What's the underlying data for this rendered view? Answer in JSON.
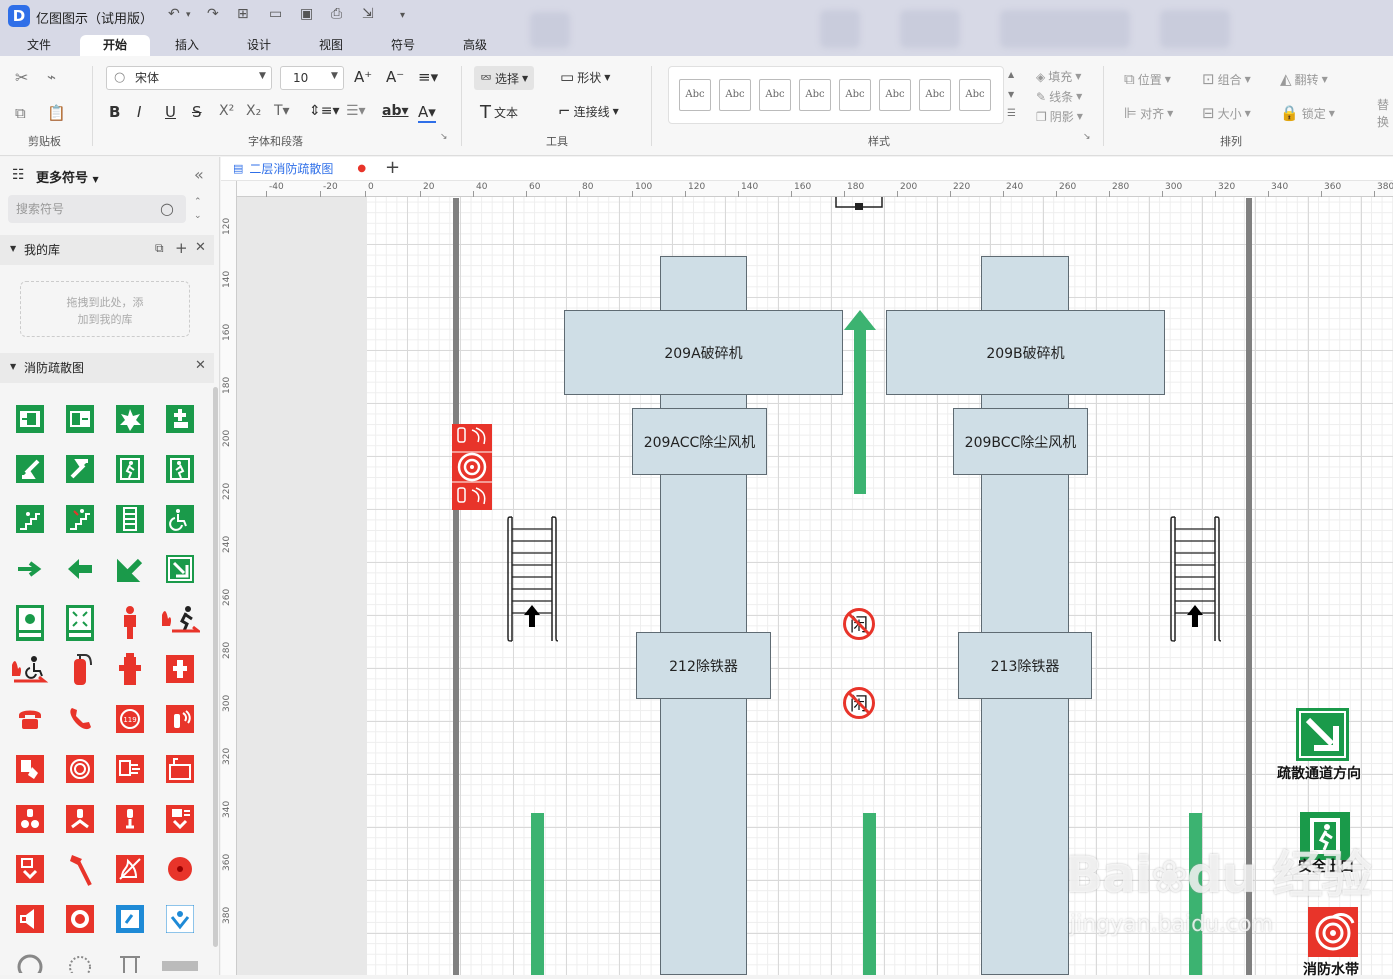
{
  "app": {
    "title": "亿图图示（试用版）"
  },
  "menu_tabs": [
    "文件",
    "开始",
    "插入",
    "设计",
    "视图",
    "符号",
    "高级"
  ],
  "ribbon": {
    "font_name": "宋体",
    "font_size": "10",
    "select_label": "选择",
    "shape_label": "形状",
    "text_label": "文本",
    "connector_label": "连接线",
    "fill_label": "填充",
    "line_label": "线条",
    "shadow_label": "阴影",
    "position_label": "位置",
    "group_label": "组合",
    "flip_label": "翻转",
    "align_label": "对齐",
    "size_label": "大小",
    "lock_label": "锁定",
    "replace_label": "替换",
    "style_sample": "Abc",
    "groups": {
      "clipboard": "剪贴板",
      "font": "字体和段落",
      "tools": "工具",
      "styles": "样式",
      "arrange": "排列"
    }
  },
  "sidebar": {
    "title": "更多符号",
    "search_placeholder": "搜索符号",
    "my_library": "我的库",
    "drop_hint_1": "拖拽到此处，添",
    "drop_hint_2": "加到我的库",
    "fire_library": "消防疏散图"
  },
  "document": {
    "tab_name": "二层消防疏散图"
  },
  "ruler": {
    "h_ticks": [
      "-40",
      "-20",
      "0",
      "20",
      "40",
      "60",
      "80",
      "100",
      "120",
      "140",
      "160",
      "180",
      "200",
      "220",
      "240",
      "260",
      "280",
      "300",
      "320",
      "340",
      "360",
      "380"
    ],
    "v_ticks": [
      "120",
      "140",
      "160",
      "180",
      "200",
      "220",
      "240",
      "260",
      "280",
      "300",
      "320",
      "340",
      "360",
      "380"
    ]
  },
  "diagram": {
    "crusher_a": "209A破碎机",
    "crusher_b": "209B破碎机",
    "fan_a": "209ACC除尘风机",
    "fan_b": "209BCC除尘风机",
    "iron_a": "212除铁器",
    "iron_b": "213除铁器",
    "evac_direction": "疏散通道方向",
    "safe_exit": "安全出口",
    "fire_hose": "消防水带",
    "no_entry_char": "闲"
  },
  "watermark": {
    "main": "Bai",
    "cn": "经验",
    "url": "jingyan.baidu.com"
  },
  "colors": {
    "accent": "#2f6fe8",
    "safety_green": "#1a9a4a",
    "fire_red": "#e8342a",
    "equipment_fill": "#cfdee6"
  }
}
